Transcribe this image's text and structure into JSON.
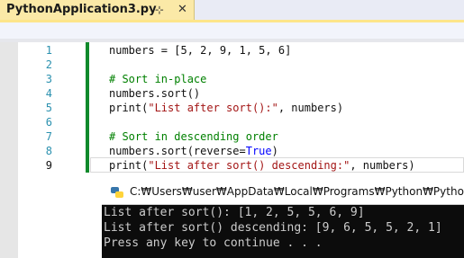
{
  "editor_tab": {
    "title": "PythonApplication3.py",
    "pin_glyph": "⊹",
    "close_glyph": "✕"
  },
  "code_lines": [
    {
      "num": "1",
      "text": "numbers = [5, 2, 9, 1, 5, 6]"
    },
    {
      "num": "2",
      "text": ""
    },
    {
      "num": "3",
      "text": "# Sort in-place"
    },
    {
      "num": "4",
      "text": "numbers.sort()"
    },
    {
      "num": "5",
      "text": "print(\"List after sort():\", numbers)"
    },
    {
      "num": "6",
      "text": ""
    },
    {
      "num": "7",
      "text": "# Sort in descending order"
    },
    {
      "num": "8",
      "text": "numbers.sort(reverse=True)"
    },
    {
      "num": "9",
      "text": "print(\"List after sort() descending:\", numbers)"
    }
  ],
  "console": {
    "title": "C:₩Users₩user₩AppData₩Local₩Programs₩Python₩Pytho",
    "lines": [
      "List after sort(): [1, 2, 5, 5, 6, 9]",
      "List after sort() descending: [9, 6, 5, 5, 2, 1]",
      "Press any key to continue . . ."
    ]
  },
  "colors": {
    "tab_active": "#fbe9a7",
    "change_bar": "#108a2c",
    "line_number": "#2b91af",
    "string": "#a31515",
    "keyword": "#0000ff",
    "comment": "#008000",
    "console_bg": "#0c0c0c",
    "console_text": "#cccccc"
  }
}
